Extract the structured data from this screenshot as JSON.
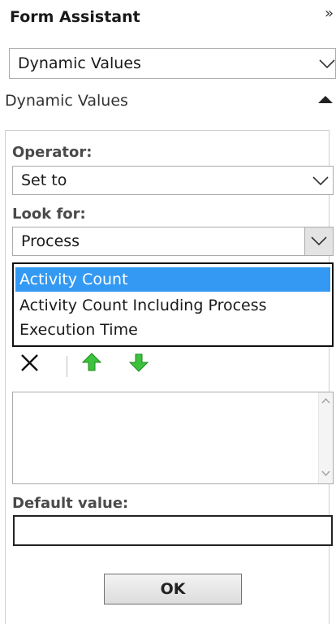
{
  "panel": {
    "title": "Form Assistant",
    "close_glyph": "»"
  },
  "top_dropdown": {
    "value": "Dynamic Values",
    "icon": "chevron-down-icon"
  },
  "section": {
    "label": "Dynamic Values",
    "expanded": true,
    "icon": "collapse-up-icon"
  },
  "operator": {
    "label": "Operator:",
    "value": "Set to"
  },
  "look_for": {
    "label": "Look for:",
    "value": "Process"
  },
  "values_list": {
    "items": [
      {
        "label": "Activity Count",
        "selected": true
      },
      {
        "label": "Activity Count Including Process",
        "selected": false
      },
      {
        "label": "Execution Time",
        "selected": false
      }
    ],
    "selection_color": "#3399f3"
  },
  "toolbar": {
    "delete_icon": "delete-x-icon",
    "move_up_icon": "green-arrow-up-icon",
    "move_down_icon": "green-arrow-down-icon"
  },
  "default_value": {
    "label": "Default value:",
    "value": ""
  },
  "ok_button": {
    "label": "OK"
  }
}
